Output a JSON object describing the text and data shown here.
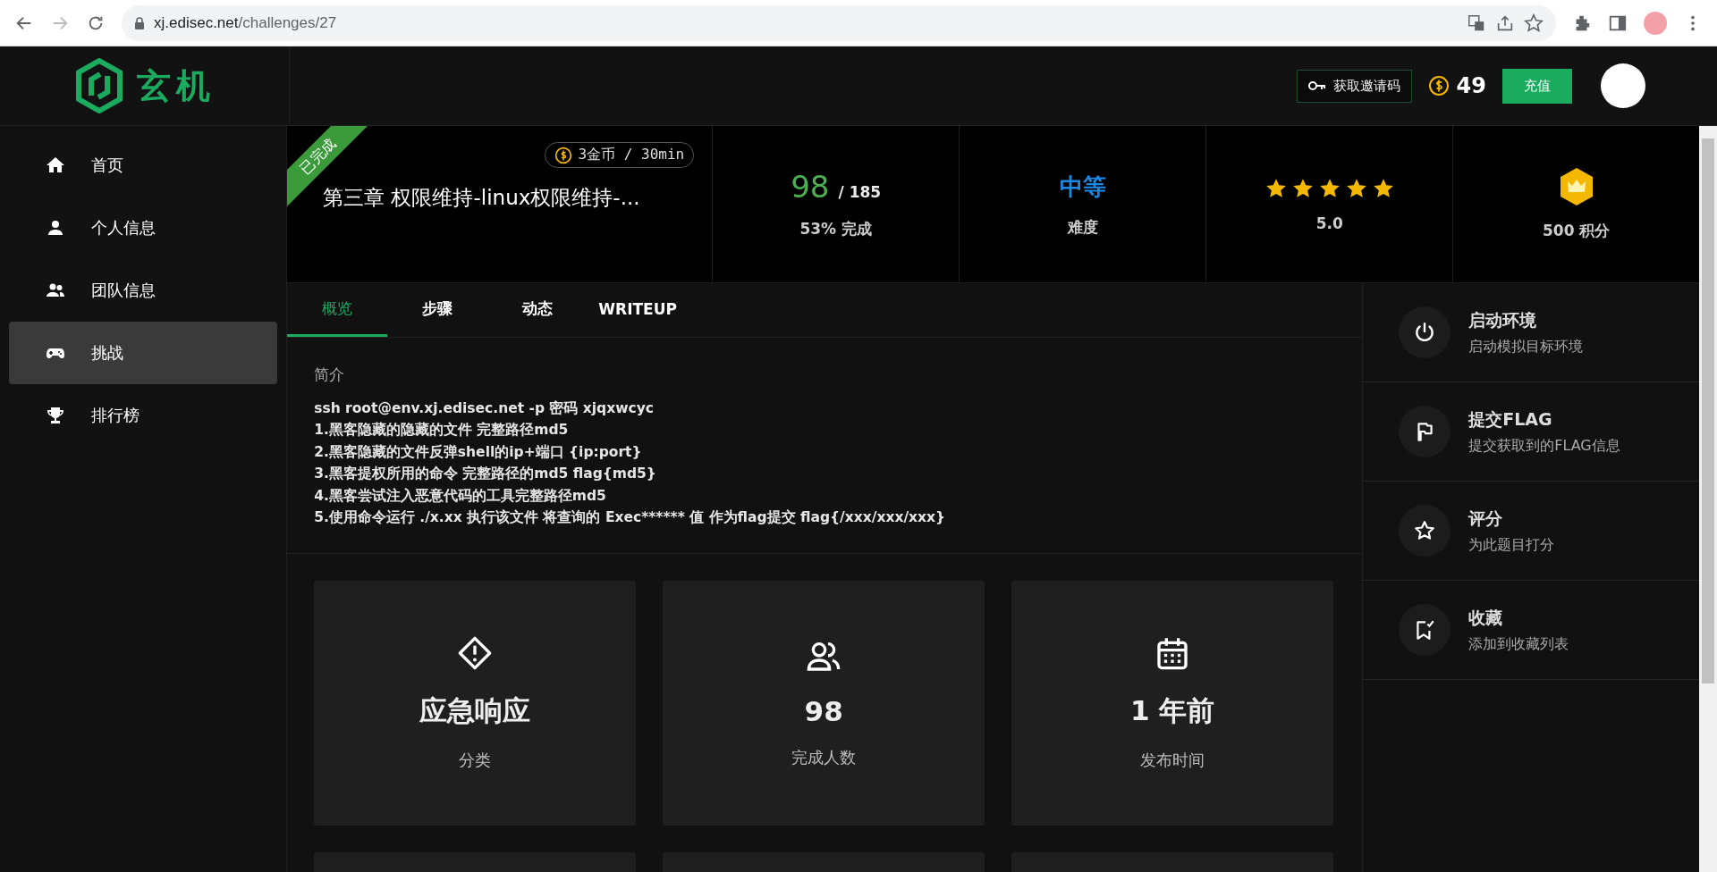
{
  "browser": {
    "url_host": "xj.edisec.net",
    "url_path": "/challenges/27"
  },
  "header": {
    "logo_text": "玄机",
    "invite_button": "获取邀请码",
    "coins": "49",
    "recharge_button": "充值"
  },
  "sidebar": {
    "items": [
      {
        "label": "首页",
        "selected": false
      },
      {
        "label": "个人信息",
        "selected": false
      },
      {
        "label": "团队信息",
        "selected": false
      },
      {
        "label": "挑战",
        "selected": true
      },
      {
        "label": "排行榜",
        "selected": false
      }
    ]
  },
  "challenge": {
    "ribbon": "已完成",
    "cost_badge": "3金币 / 30min",
    "title": "第三章 权限维持-linux权限维持-..."
  },
  "stats": {
    "solved": "98",
    "total": "/ 185",
    "progress_label": "53% 完成",
    "difficulty": "中等",
    "difficulty_label": "难度",
    "stars": 5,
    "rating": "5.0",
    "points": "500 积分"
  },
  "tabs": [
    {
      "label": "概览",
      "selected": true
    },
    {
      "label": "步骤",
      "selected": false
    },
    {
      "label": "动态",
      "selected": false
    },
    {
      "label": "WRITEUP",
      "selected": false
    }
  ],
  "intro": {
    "heading": "简介",
    "lines": [
      "ssh root@env.xj.edisec.net -p  密码  xjqxwcyc",
      "1.黑客隐藏的隐藏的文件 完整路径md5",
      "2.黑客隐藏的文件反弹shell的ip+端口 {ip:port}",
      "3.黑客提权所用的命令 完整路径的md5 flag{md5}",
      "4.黑客尝试注入恶意代码的工具完整路径md5",
      "5.使用命令运行 ./x.xx 执行该文件  将查询的 Exec****** 值 作为flag提交 flag{/xxx/xxx/xxx}"
    ]
  },
  "info_cards": [
    {
      "value": "应急响应",
      "label": "分类"
    },
    {
      "value": "98",
      "label": "完成人数"
    },
    {
      "value": "1 年前",
      "label": "发布时间"
    }
  ],
  "actions": [
    {
      "title": "启动环境",
      "subtitle": "启动模拟目标环境"
    },
    {
      "title": "提交FLAG",
      "subtitle": "提交获取到的FLAG信息"
    },
    {
      "title": "评分",
      "subtitle": "为此题目打分"
    },
    {
      "title": "收藏",
      "subtitle": "添加到收藏列表"
    }
  ]
}
